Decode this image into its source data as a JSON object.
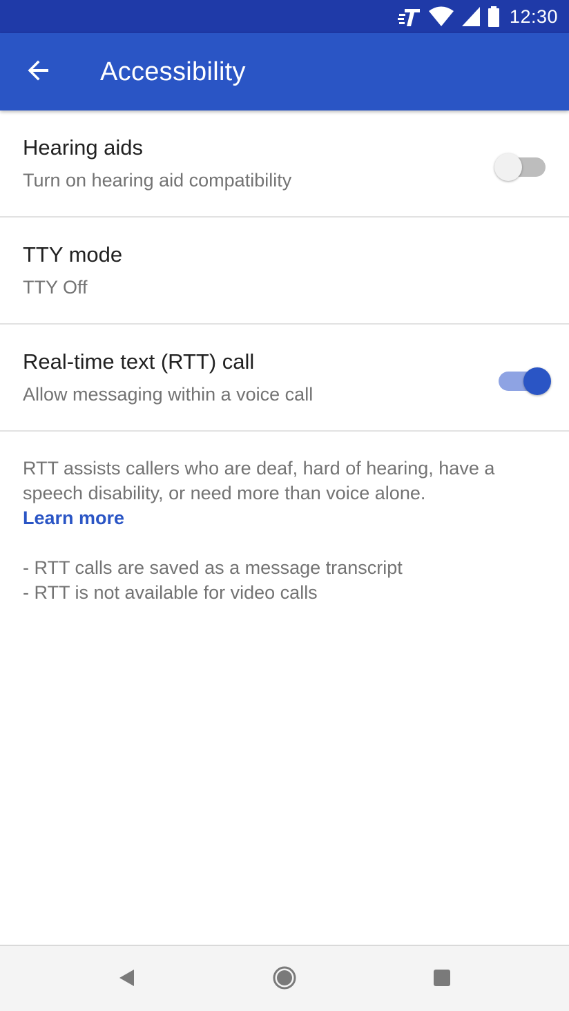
{
  "status_bar": {
    "time": "12:30",
    "icons": [
      "carrier-t-icon",
      "wifi-icon",
      "signal-icon",
      "battery-icon"
    ]
  },
  "app_bar": {
    "title": "Accessibility",
    "back_icon": "arrow-back-icon"
  },
  "settings": [
    {
      "title": "Hearing aids",
      "summary": "Turn on hearing aid compatibility",
      "toggle": false
    },
    {
      "title": "TTY mode",
      "summary": "TTY Off"
    },
    {
      "title": "Real-time text (RTT) call",
      "summary": "Allow messaging within a voice call",
      "toggle": true
    }
  ],
  "info": {
    "description": "RTT assists callers who are deaf, hard of hearing, have a speech disability, or need more than voice alone.",
    "learn_more": "Learn more",
    "notes": [
      "- RTT calls are saved as a message transcript",
      "- RTT is not available for video calls"
    ]
  },
  "nav_bar": {
    "icons": [
      "nav-back-icon",
      "nav-home-icon",
      "nav-recents-icon"
    ]
  },
  "colors": {
    "status_bar": "#1f3aa8",
    "app_bar": "#2a55c5",
    "accent": "#2a55c5",
    "text_primary": "#212121",
    "text_secondary": "#737373"
  }
}
